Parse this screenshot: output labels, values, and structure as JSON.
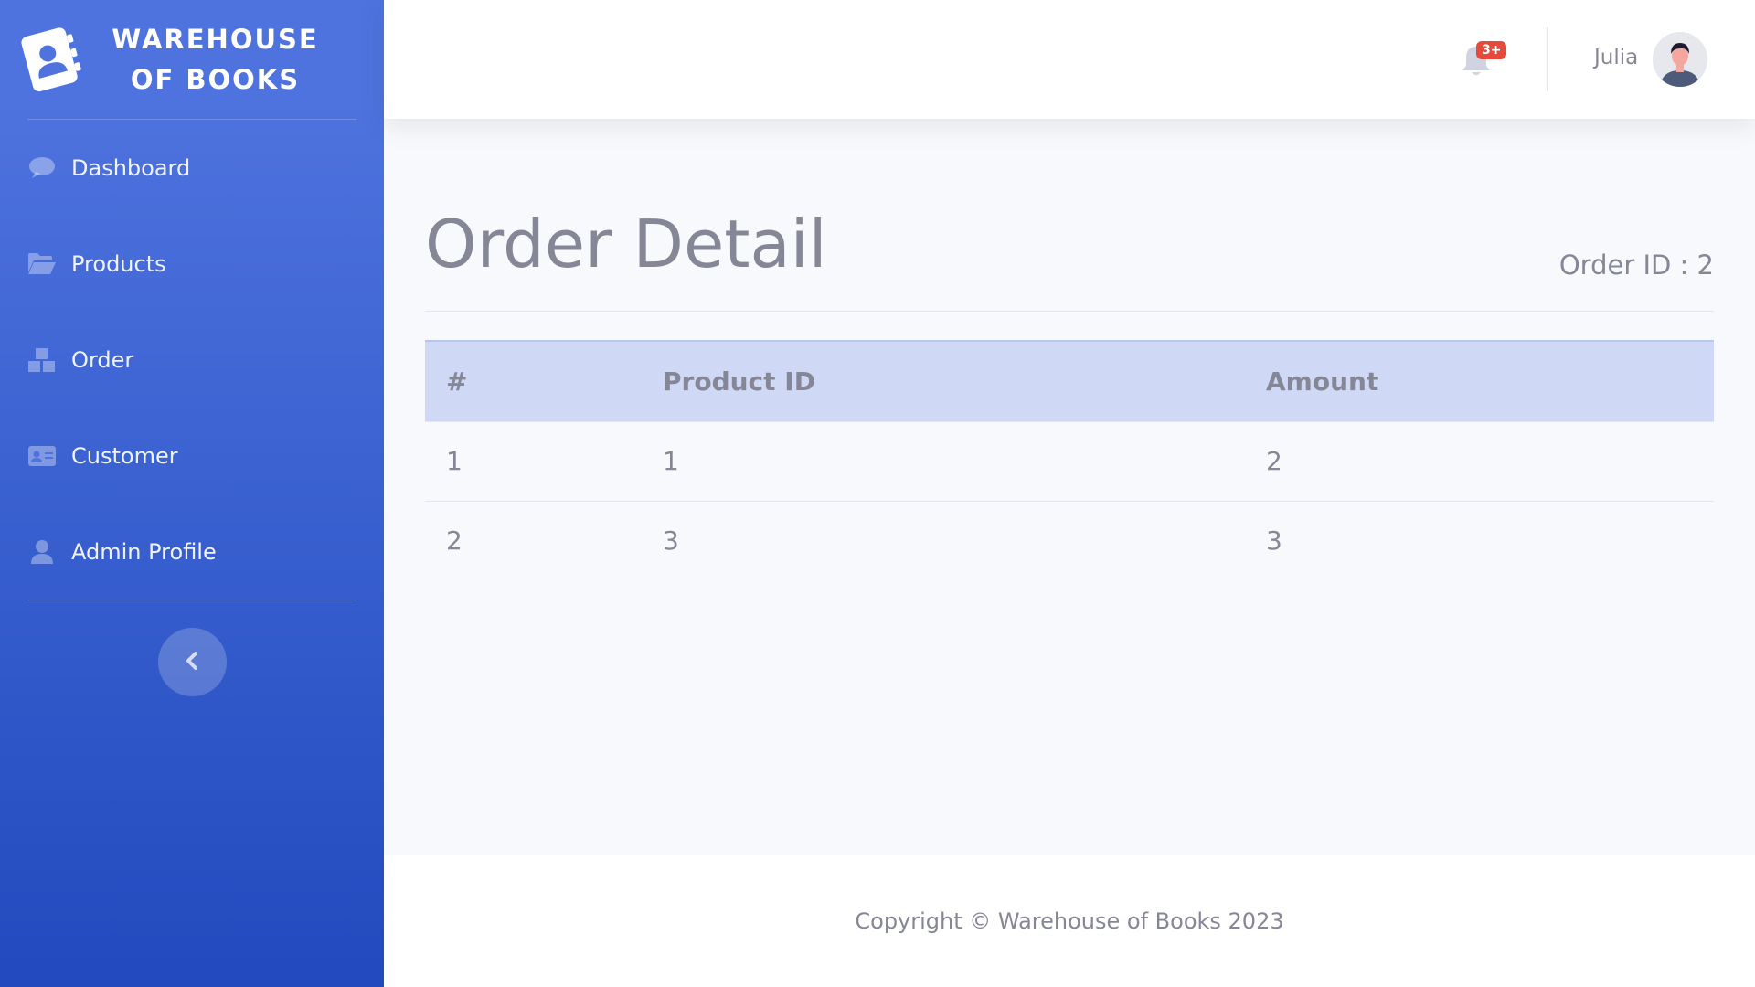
{
  "brand": {
    "name": "Warehouse of Books",
    "icon": "address-book-icon"
  },
  "sidebar": {
    "items": [
      {
        "label": "Dashboard",
        "icon": "comment-icon"
      },
      {
        "label": "Products",
        "icon": "folder-open-icon"
      },
      {
        "label": "Order",
        "icon": "boxes-icon"
      },
      {
        "label": "Customer",
        "icon": "id-card-icon"
      },
      {
        "label": "Admin Profile",
        "icon": "user-icon"
      }
    ],
    "toggle_icon": "chevron-left-icon"
  },
  "topbar": {
    "alerts_badge": "3+",
    "username": "Julia"
  },
  "main": {
    "title": "Order Detail",
    "order_id": "Order ID : 2",
    "table": {
      "headers": [
        "#",
        "Product ID",
        "Amount"
      ],
      "rows": [
        [
          "1",
          "1",
          "2"
        ],
        [
          "2",
          "3",
          "3"
        ]
      ]
    }
  },
  "footer": {
    "copyright": "Copyright © Warehouse of Books 2023"
  },
  "colors": {
    "sidebar_top": "#4e73df",
    "sidebar_bottom": "#224abe",
    "table_header_bg": "#cfd9f5",
    "badge": "#e74a3b",
    "text": "#858796"
  }
}
